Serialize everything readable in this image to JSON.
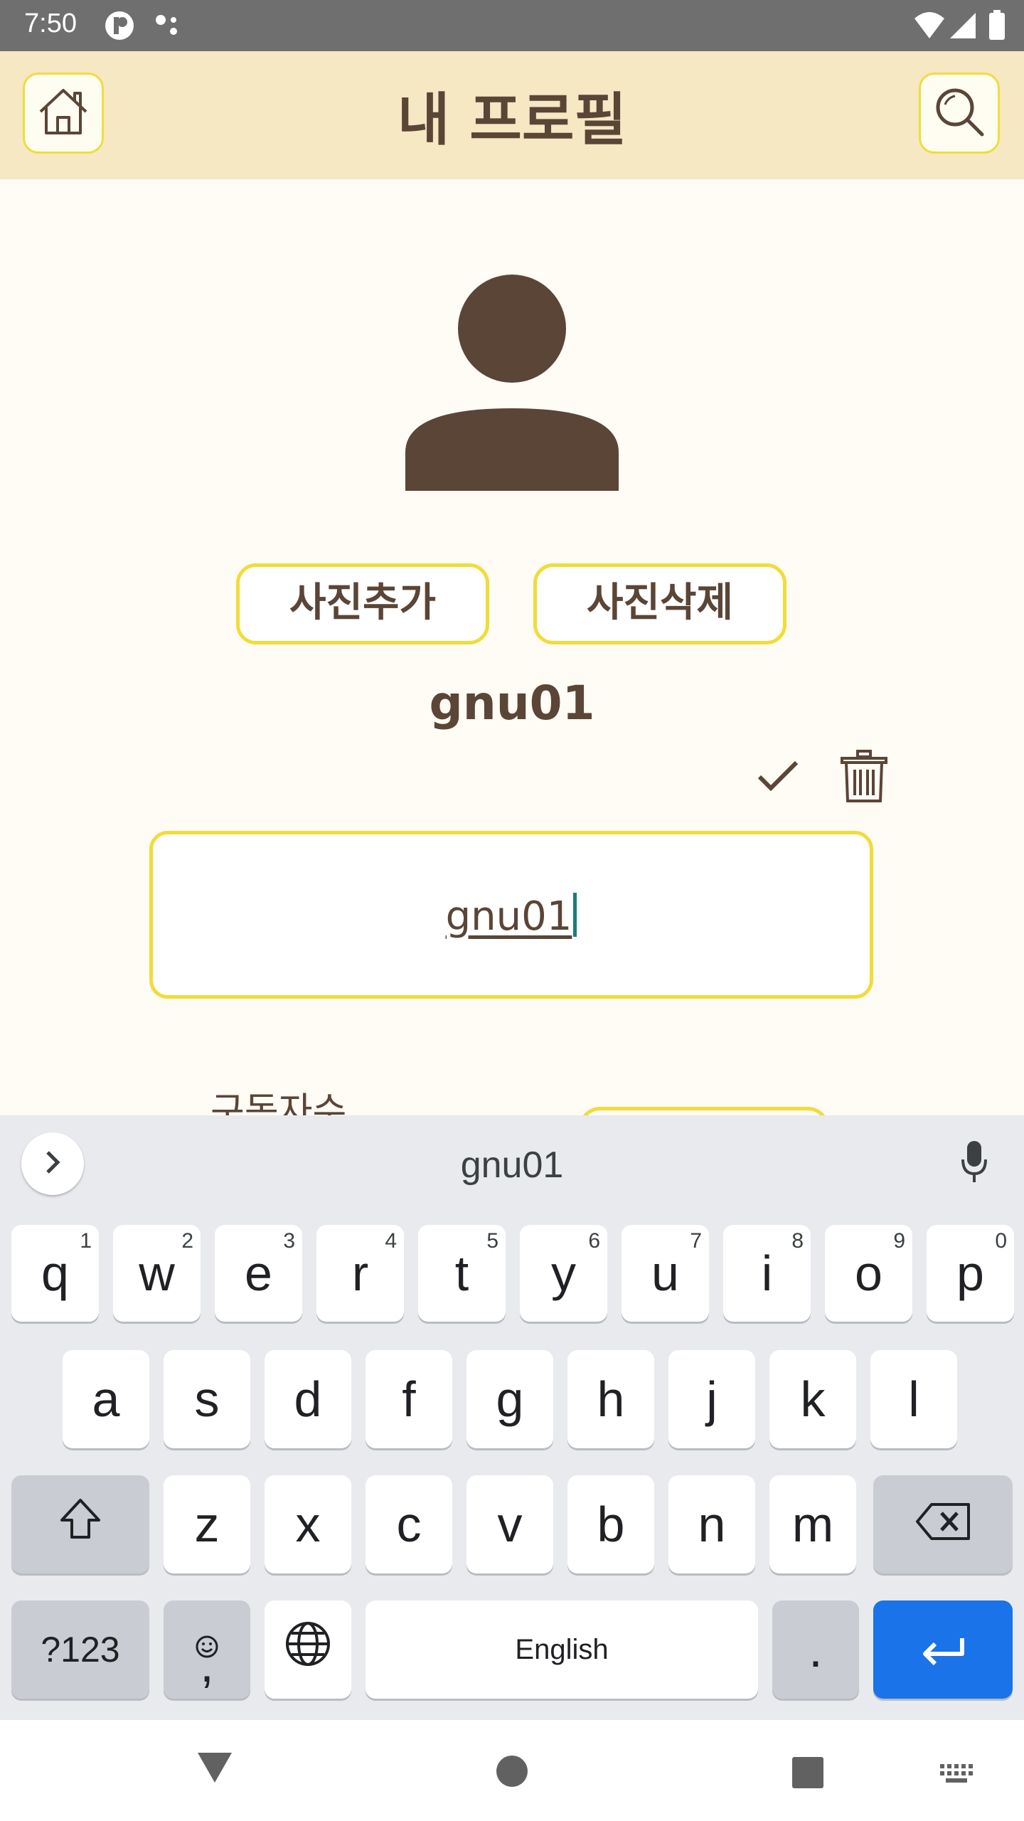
{
  "status_bar": {
    "time": "7:50"
  },
  "app_bar": {
    "title": "내 프로필"
  },
  "profile": {
    "add_photo_label": "사진추가",
    "delete_photo_label": "사진삭제",
    "username": "gnu01",
    "edit_field_value": "gnu01",
    "subscriber_label": "구독자수"
  },
  "keyboard": {
    "suggestion": "gnu01",
    "row1": [
      {
        "k": "q",
        "h": "1"
      },
      {
        "k": "w",
        "h": "2"
      },
      {
        "k": "e",
        "h": "3"
      },
      {
        "k": "r",
        "h": "4"
      },
      {
        "k": "t",
        "h": "5"
      },
      {
        "k": "y",
        "h": "6"
      },
      {
        "k": "u",
        "h": "7"
      },
      {
        "k": "i",
        "h": "8"
      },
      {
        "k": "o",
        "h": "9"
      },
      {
        "k": "p",
        "h": "0"
      }
    ],
    "row2": [
      "a",
      "s",
      "d",
      "f",
      "g",
      "h",
      "j",
      "k",
      "l"
    ],
    "row3": [
      "z",
      "x",
      "c",
      "v",
      "b",
      "n",
      "m"
    ],
    "symbols_label": "?123",
    "comma_label": ",",
    "space_label": "English",
    "period_label": "."
  },
  "colors": {
    "accent_border": "#f1dc3a",
    "brown": "#5a4537",
    "header_bg": "#f5e8c3",
    "enter_key": "#1a73e8"
  }
}
